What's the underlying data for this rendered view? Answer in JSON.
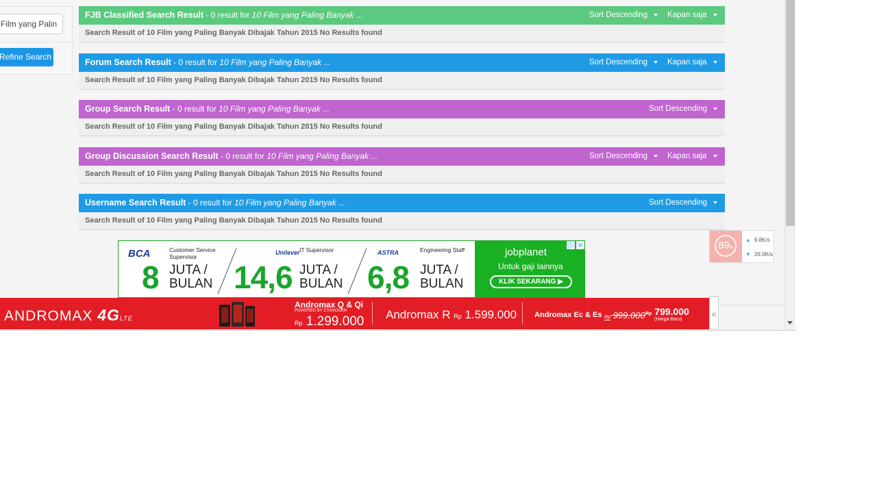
{
  "sidebar": {
    "search_value": "Film yang Palin",
    "refine_label": "Refine Search"
  },
  "sections": [
    {
      "title": "FJB Classified Search Result",
      "summary": " - 0 result for ",
      "query": "10 Film yang Paling Banyak ...",
      "sort_label": "Sort Descending",
      "time_label": "Kapan saja",
      "body": "Search Result of 10 Film yang Paling Banyak Dibajak Tahun 2015 No Results found",
      "color": "#5bc97f"
    },
    {
      "title": "Forum Search Result",
      "summary": " - 0 result for ",
      "query": "10 Film yang Paling Banyak ...",
      "sort_label": "Sort Descending",
      "time_label": "Kapan saja",
      "body": "Search Result of 10 Film yang Paling Banyak Dibajak Tahun 2015 No Results found",
      "color": "#1f9be6"
    },
    {
      "title": "Group Search Result",
      "summary": " - 0 result for ",
      "query": "10 Film yang Paling Banyak ...",
      "sort_label": "Sort Descending",
      "body": "Search Result of 10 Film yang Paling Banyak Dibajak Tahun 2015 No Results found",
      "color": "#c064cf"
    },
    {
      "title": "Group Discussion Search Result",
      "summary": " - 0 result for ",
      "query": "10 Film yang Paling Banyak ...",
      "sort_label": "Sort Descending",
      "time_label": "Kapan saja",
      "body": "Search Result of 10 Film yang Paling Banyak Dibajak Tahun 2015 No Results found",
      "color": "#c064cf"
    },
    {
      "title": "Username Search Result",
      "summary": " - 0 result for ",
      "query": "10 Film yang Paling Banyak ...",
      "sort_label": "Sort Descending",
      "body": "Search Result of 10 Film yang Paling Banyak Dibajak Tahun 2015 No Results found",
      "color": "#1f9be6"
    }
  ],
  "ad_jobs": {
    "jobs": [
      {
        "company": "BCA",
        "role": "Customer Service Supervisor",
        "salary": "8",
        "unit_line1": "JUTA /",
        "unit_line2": "BULAN"
      },
      {
        "company": "Unilever",
        "role": "IT Supervisor",
        "salary": "14,6",
        "unit_line1": "JUTA /",
        "unit_line2": "BULAN"
      },
      {
        "company": "ASTRA",
        "role": "Engineering Staff",
        "salary": "6,8",
        "unit_line1": "JUTA /",
        "unit_line2": "BULAN"
      }
    ],
    "brand": "jobplanet",
    "tagline": "Untuk gaji lainnya",
    "cta": "KLIK SEKARANG ▶",
    "info_icon": "ⓘ",
    "close_icon": "✕"
  },
  "ad_andromax": {
    "brand": "ANDROMAX",
    "tech": "4G",
    "tech_suffix": "LTE",
    "p1_title": "Andromax Q & Qi",
    "p1_sub": "POWERED BY CYANOGEN",
    "p1_currency": "Rp",
    "p1_price": "1.299.000",
    "p2_title": "Andromax R",
    "p2_currency": "Rp",
    "p2_price": "1.599.000",
    "p3_title": "Andromax Ec & Es",
    "p3_old_currency": "Rp",
    "p3_old_price": "999.000",
    "p3_new_currency": "Rp",
    "p3_new_price": "799.000",
    "p3_note": "(Harga Baru)"
  },
  "collapse_glyph": "«",
  "net_widget": {
    "percent": "89",
    "percent_unit": "%",
    "upload": "9.8K/s",
    "download": "26.0K/s",
    "up_glyph": "▲",
    "down_glyph": "▼"
  },
  "colors": {
    "green": "#5bc97f",
    "blue": "#1f9be6",
    "purple": "#c064cf",
    "ad_red": "#e21d25",
    "jobplanet_green": "#19b123"
  }
}
